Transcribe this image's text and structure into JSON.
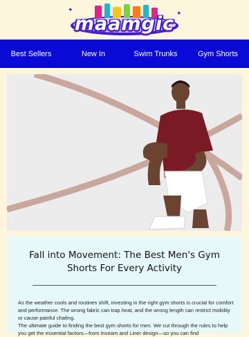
{
  "brand": {
    "logo_text": "maamgic"
  },
  "nav": {
    "items": [
      {
        "label": "Best Sellers"
      },
      {
        "label": "New In"
      },
      {
        "label": "Swim Trunks"
      },
      {
        "label": "Gym Shorts"
      }
    ]
  },
  "hero": {
    "image": "man-stretching-in-gym-shorts"
  },
  "article": {
    "title": "Fall into Movement: The Best Men's Gym Shorts For Every Activity",
    "paragraphs": [
      "As the weather cools and routines shift, investing in the right gym shorts is crucial for comfort and performance. The wrong fabric can trap heat, and the wrong length can restrict mobility or cause painful chafing.",
      "The ultimate guide to finding the best gym shorts for men. We cut through the rules to help you get the essential factors—from Inseam and Liner design—so you can find"
    ]
  },
  "colors": {
    "nav_bg": "#0a0ad6",
    "page_bg": "#fdf6dc",
    "content_bg": "#e6f8f7",
    "logo_blue": "#3b1bd6"
  }
}
